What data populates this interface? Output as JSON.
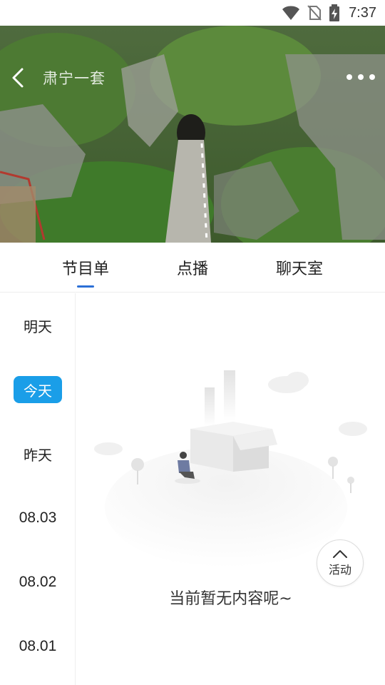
{
  "status_bar": {
    "time": "7:37"
  },
  "video": {
    "channel_title": "肃宁一套"
  },
  "tabs": [
    {
      "label": "节目单",
      "active": true
    },
    {
      "label": "点播",
      "active": false
    },
    {
      "label": "聊天室",
      "active": false
    }
  ],
  "dates": [
    {
      "label": "明天",
      "selected": false
    },
    {
      "label": "今天",
      "selected": true
    },
    {
      "label": "昨天",
      "selected": false
    },
    {
      "label": "08.03",
      "selected": false
    },
    {
      "label": "08.02",
      "selected": false
    },
    {
      "label": "08.01",
      "selected": false
    }
  ],
  "empty_state": {
    "message": "当前暂无内容呢~"
  },
  "activity_button": {
    "label": "活动",
    "icon": "chevron-up-icon"
  },
  "colors": {
    "accent": "#2b6fd6",
    "selected_pill": "#1a9ee8"
  }
}
